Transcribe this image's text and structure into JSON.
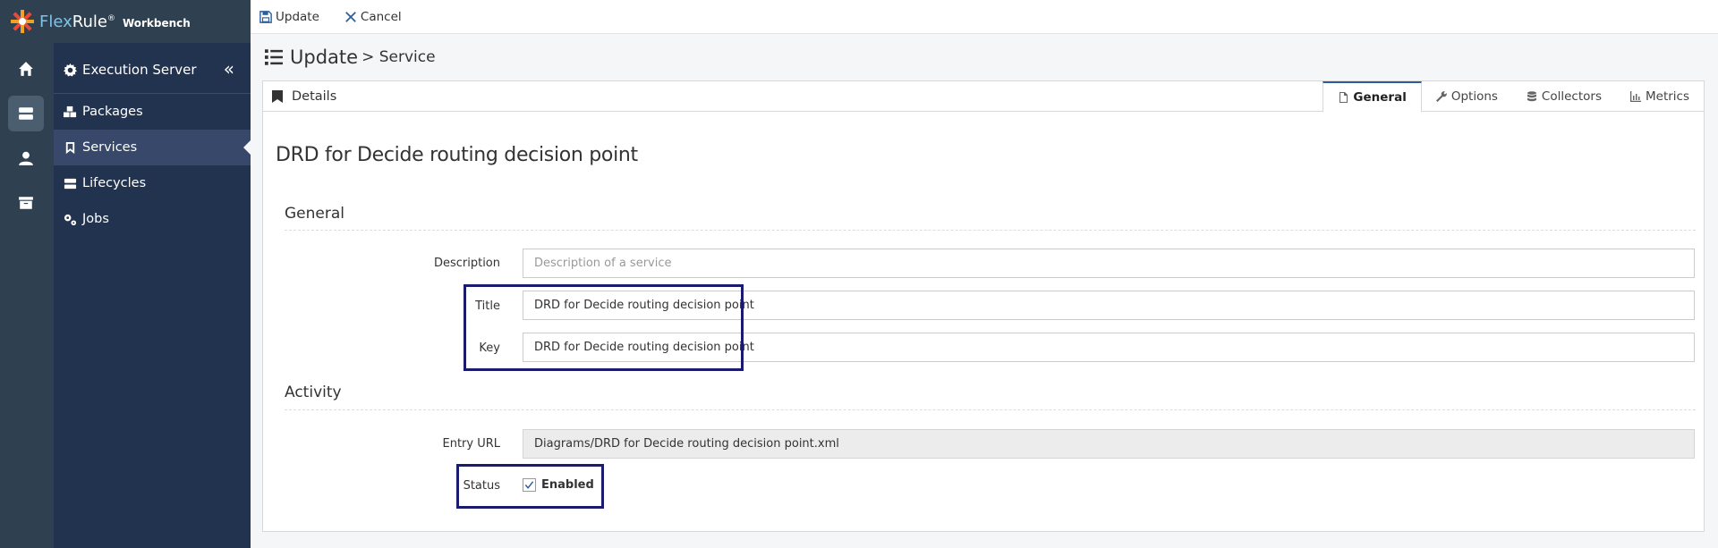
{
  "app": {
    "brand_flex": "Flex",
    "brand_rule": "Rule",
    "brand_reg": "®",
    "brand_suffix": "Workbench"
  },
  "rail": {
    "items": [
      {
        "icon": "home-icon"
      },
      {
        "icon": "server-icon",
        "active": true
      },
      {
        "icon": "user-icon"
      },
      {
        "icon": "archive-icon"
      }
    ]
  },
  "sidebar": {
    "header": "Execution Server",
    "collapse_label": "«",
    "items": [
      {
        "label": "Packages",
        "icon": "cubes-icon"
      },
      {
        "label": "Services",
        "icon": "bookmark-icon",
        "active": true
      },
      {
        "label": "Lifecycles",
        "icon": "server-icon"
      },
      {
        "label": "Jobs",
        "icon": "cogs-icon"
      }
    ]
  },
  "toolbar": {
    "update_label": "Update",
    "cancel_label": "Cancel"
  },
  "page": {
    "title_main": "Update",
    "title_sub": "> Service"
  },
  "panel": {
    "details_label": "Details",
    "tabs": [
      {
        "label": "General",
        "icon": "file-icon",
        "active": true
      },
      {
        "label": "Options",
        "icon": "wrench-icon"
      },
      {
        "label": "Collectors",
        "icon": "database-icon"
      },
      {
        "label": "Metrics",
        "icon": "chart-icon"
      }
    ]
  },
  "form": {
    "service_title": "DRD for Decide routing decision point",
    "general_section": "General",
    "description_label": "Description",
    "description_placeholder": "Description of a service",
    "title_label": "Title",
    "title_value": "DRD for Decide routing decision point",
    "key_label": "Key",
    "key_value": "DRD for Decide routing decision point",
    "activity_section": "Activity",
    "entry_url_label": "Entry URL",
    "entry_url_value": "Diagrams/DRD for Decide routing decision point.xml",
    "status_label": "Status",
    "status_value": "Enabled",
    "status_checked": true
  },
  "colors": {
    "rail_bg": "#2f4150",
    "sidebar_bg": "#223350",
    "sidebar_active": "#37486a",
    "highlight_border": "#1a1a6e",
    "accent": "#2a5d9a"
  }
}
